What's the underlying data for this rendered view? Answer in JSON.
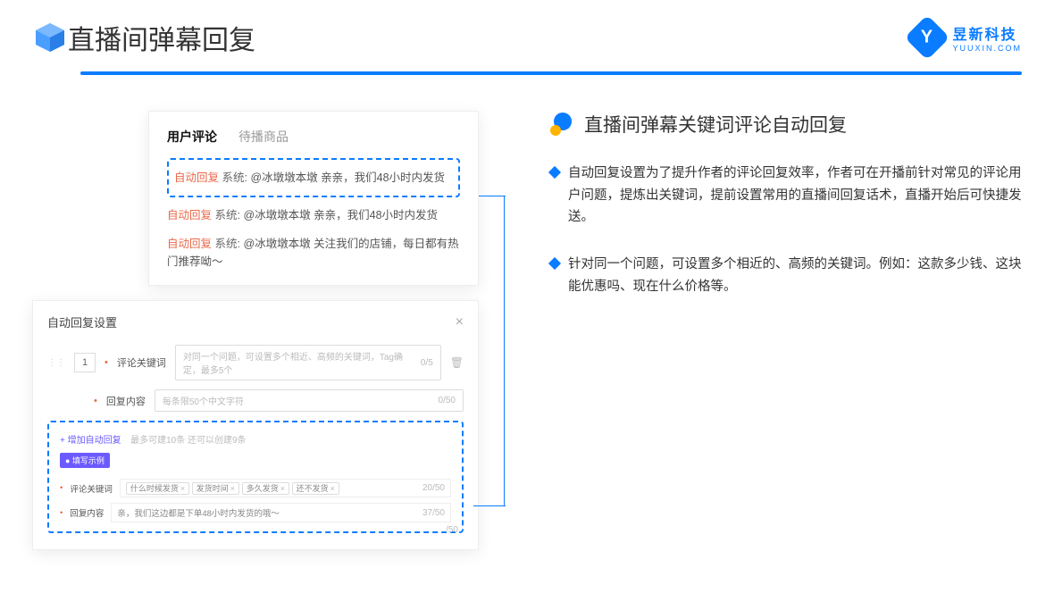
{
  "header": {
    "title": "直播间弹幕回复"
  },
  "brand": {
    "name": "昱新科技",
    "sub": "YUUXIN.COM",
    "letter": "Y"
  },
  "comments_card": {
    "tabs": {
      "active": "用户评论",
      "inactive": "待播商品"
    },
    "highlighted": {
      "tag": "自动回复",
      "sys": "系统:",
      "text": "@冰墩墩本墩 亲亲，我们48小时内发货"
    },
    "rows": [
      {
        "tag": "自动回复",
        "sys": "系统:",
        "text": "@冰墩墩本墩 亲亲，我们48小时内发货"
      },
      {
        "tag": "自动回复",
        "sys": "系统:",
        "text": "@冰墩墩本墩 关注我们的店铺，每日都有热门推荐呦～"
      }
    ]
  },
  "settings_card": {
    "title": "自动回复设置",
    "close": "×",
    "row_num": "1",
    "keyword_label": "评论关键词",
    "keyword_placeholder": "对同一个问题，可设置多个相近、高频的关键词，Tag确定，最多5个",
    "keyword_counter": "0/5",
    "content_label": "回复内容",
    "content_placeholder": "每条限50个中文字符",
    "content_counter": "0/50",
    "add_link": "+ 增加自动回复",
    "add_hint": "最多可建10条 还可以创建9条",
    "example_badge": "● 填写示例",
    "example_keyword_label": "评论关键词",
    "example_chips": [
      "什么时候发货",
      "发货时间",
      "多久发货",
      "还不发货"
    ],
    "example_chip_counter": "20/50",
    "example_content_label": "回复内容",
    "example_content_text": "亲，我们这边都是下单48小时内发货的哦～",
    "example_content_counter": "37/50",
    "outside_counter": "/50"
  },
  "section": {
    "title": "直播间弹幕关键词评论自动回复",
    "bullets": [
      "自动回复设置为了提升作者的评论回复效率，作者可在开播前针对常见的评论用户问题，提炼出关键词，提前设置常用的直播间回复话术，直播开始后可快捷发送。",
      "针对同一个问题，可设置多个相近的、高频的关键词。例如：这款多少钱、这块能优惠吗、现在什么价格等。"
    ]
  }
}
